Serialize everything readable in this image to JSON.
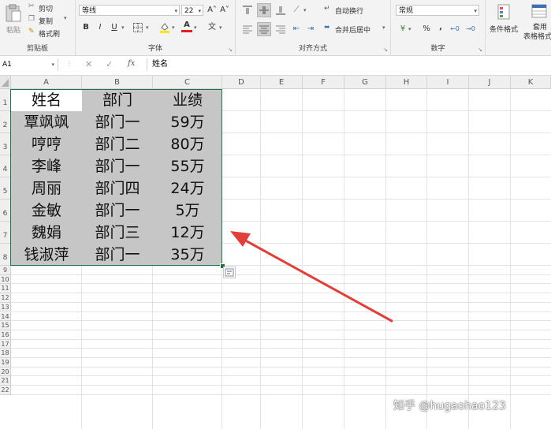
{
  "ribbon": {
    "clipboard": {
      "paste_label": "粘贴",
      "cut_label": "剪切",
      "copy_label": "复制",
      "format_painter_label": "格式刷",
      "group_label": "剪贴板"
    },
    "font": {
      "font_name": "等线",
      "font_size": "22",
      "bold": "B",
      "italic": "I",
      "underline": "U",
      "font_color_glyph": "A",
      "grow_glyph": "A˄",
      "shrink_glyph": "A˅",
      "group_label": "字体"
    },
    "alignment": {
      "wrap_text_label": "自动换行",
      "merge_center_label": "合并后居中",
      "group_label": "对齐方式"
    },
    "number": {
      "format_value": "常规",
      "percent": "%",
      "comma": ",",
      "group_label": "数字"
    },
    "styles": {
      "conditional_format_label": "条件格式",
      "table_format_label_1": "套用",
      "table_format_label_2": "表格格式"
    }
  },
  "formula_bar": {
    "name_box": "A1",
    "fx": "fx",
    "content": "姓名"
  },
  "columns": [
    "A",
    "B",
    "C",
    "D",
    "E",
    "F",
    "G",
    "H",
    "I",
    "J",
    "K"
  ],
  "rows": [
    "1",
    "2",
    "3",
    "4",
    "5",
    "6",
    "7",
    "8",
    "9",
    "10",
    "11",
    "12",
    "13",
    "14",
    "15",
    "16",
    "17",
    "18",
    "19",
    "20",
    "21",
    "22"
  ],
  "table": {
    "header": [
      "姓名",
      "部门",
      "业绩"
    ],
    "rows": [
      [
        "覃飒飒",
        "部门一",
        "59万"
      ],
      [
        "哼哼",
        "部门二",
        "80万"
      ],
      [
        "李峰",
        "部门一",
        "55万"
      ],
      [
        "周丽",
        "部门四",
        "24万"
      ],
      [
        "金敏",
        "部门一",
        "5万"
      ],
      [
        "魏娟",
        "部门三",
        "12万"
      ],
      [
        "钱淑萍",
        "部门一",
        "35万"
      ]
    ]
  },
  "watermark": "知乎 @hugaohao123",
  "colors": {
    "selection_fill": "#c6c6c6",
    "active_cell": "#ffffff",
    "selection_border": "#217346",
    "arrow": "#e0403a"
  }
}
